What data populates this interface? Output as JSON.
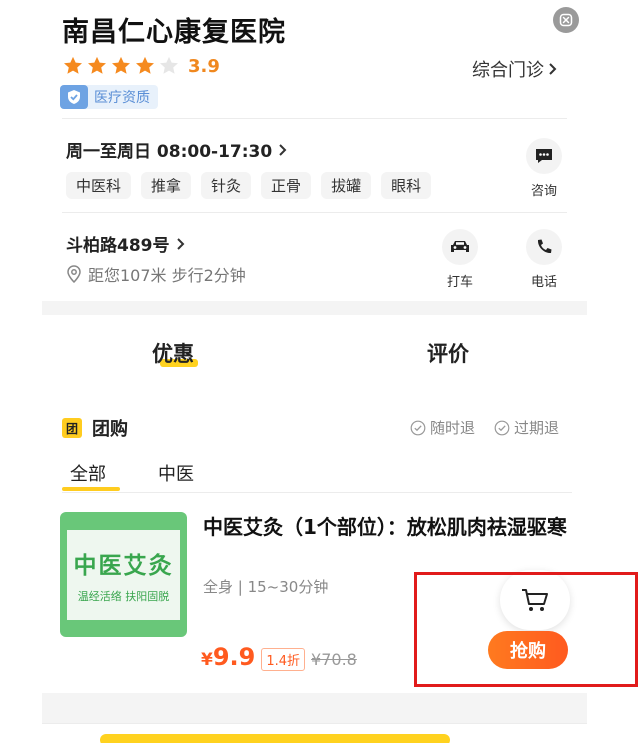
{
  "clinic": {
    "name": "南昌仁心康复医院",
    "rating": "3.9",
    "stars_filled": 4,
    "stars_total": 5,
    "overall_link": "综合门诊",
    "qualification": "医疗资质"
  },
  "hours": {
    "text": "周一至周日 08:00-17:30"
  },
  "tags": [
    "中医科",
    "推拿",
    "针灸",
    "正骨",
    "拔罐",
    "眼科"
  ],
  "actions": {
    "consult": "咨询",
    "taxi": "打车",
    "phone": "电话"
  },
  "location": {
    "address": "斗柏路489号",
    "distance": "距您107米 步行2分钟"
  },
  "main_tabs": {
    "deals": "优惠",
    "reviews": "评价"
  },
  "group": {
    "icon_text": "团",
    "title": "团购",
    "policy_1": "随时退",
    "policy_2": "过期退"
  },
  "sub_tabs": {
    "all": "全部",
    "tcm": "中医"
  },
  "product": {
    "thumb_title": "中医艾灸",
    "thumb_sub": "温经活络 扶阳固脱",
    "title": "中医艾灸（1个部位）：放松肌肉祛湿驱寒",
    "meta": "全身 | 15~30分钟",
    "price_symbol": "¥",
    "price": "9.9",
    "discount": "1.4折",
    "original_price": "¥70.8",
    "buy_label": "抢购"
  },
  "colors": {
    "accent": "#ff5a1f",
    "highlight": "#e11b1b",
    "yellow": "#ffcc1f",
    "star": "#f58a1f"
  }
}
